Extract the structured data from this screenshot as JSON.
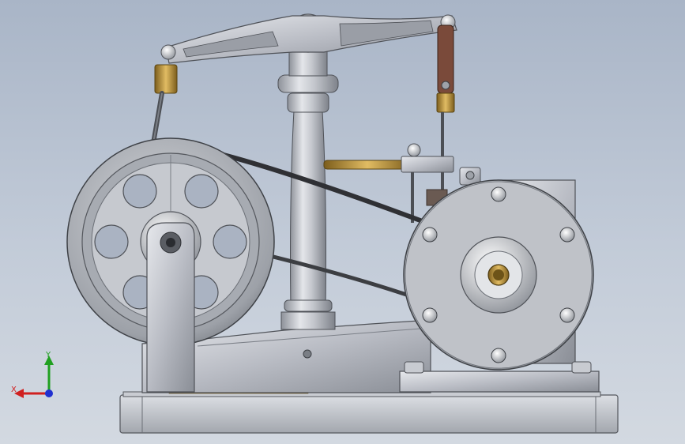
{
  "viewport": {
    "background_top": "#a9b5c7",
    "background_bottom": "#d3d9e1",
    "model": {
      "metal_color": "#b9bcc4",
      "brass_color": "#b8923a",
      "copper_link_color": "#7a4a3a",
      "belt_color": "#3a3a3a"
    }
  },
  "triad": {
    "x_label": "X",
    "y_label": "Y",
    "x_color": "#d02020",
    "y_color": "#20a020",
    "z_color": "#2030d0",
    "icons": {
      "triad": "coordinate-triad-icon"
    }
  }
}
